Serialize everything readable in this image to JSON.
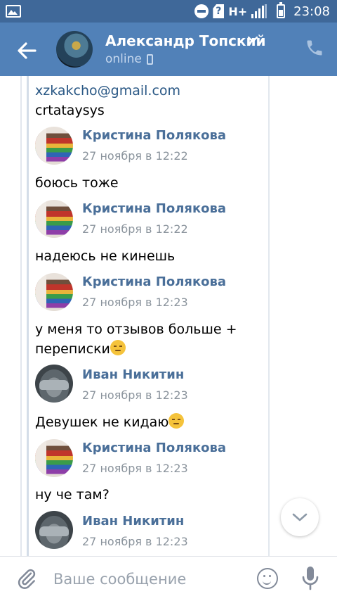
{
  "statusbar": {
    "network": "H+",
    "time": "23:08"
  },
  "header": {
    "contact_name": "Александр Топский",
    "status": "online"
  },
  "messages": {
    "forwarded_email": "xzkakcho@gmail.com",
    "forwarded_text": "crtataysys",
    "items": [
      {
        "sender": "Кристина Полякова",
        "date": "27 ноября в 12:22",
        "text": "боюсь тоже"
      },
      {
        "sender": "Кристина Полякова",
        "date": "27 ноября в 12:22",
        "text": "надеюсь не кинешь"
      },
      {
        "sender": "Кристина Полякова",
        "date": "27 ноября в 12:23",
        "text_line1": "у меня то отзывов больше +",
        "text_line2": "переписки"
      },
      {
        "sender": "Иван Никитин",
        "date": "27 ноября в 12:23",
        "text": "Девушек не кидаю"
      },
      {
        "sender": "Кристина Полякова",
        "date": "27 ноября в 12:23",
        "text": "ну че там?"
      },
      {
        "sender": "Иван Никитин",
        "date": "27 ноября в 12:23"
      }
    ]
  },
  "composer": {
    "placeholder": "Ваше сообщение"
  },
  "colors": {
    "statusbar": "#3f6899",
    "header": "#5181b8",
    "sender_name": "#4a6f99",
    "link": "#2a5885"
  },
  "icons": [
    "gallery-icon",
    "dnd-icon",
    "sim-icon",
    "signal-icon",
    "battery-icon",
    "back-arrow-icon",
    "chevron-down-icon",
    "phone-icon",
    "chevron-down-icon",
    "attach-icon",
    "emoji-icon",
    "mic-icon"
  ]
}
